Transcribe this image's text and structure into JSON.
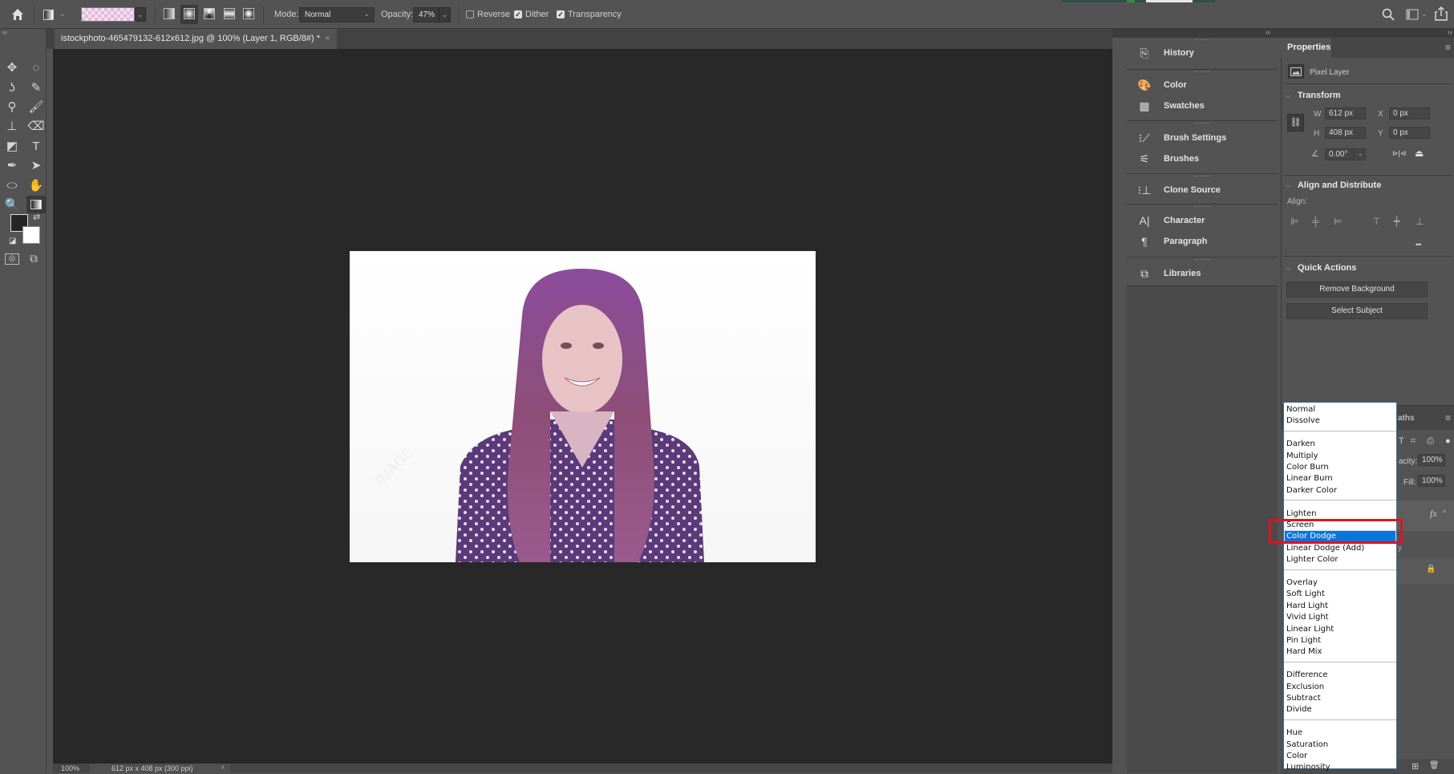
{
  "options_bar": {
    "home_icon": "home-icon",
    "gradient_tool_icon": "gradient-tool-icon",
    "gradient_preset": "transparent-pink-checker",
    "gradient_types": [
      "linear",
      "radial",
      "angle",
      "reflected",
      "diamond"
    ],
    "selected_gradient_type": "radial",
    "mode_label": "Mode:",
    "mode_value": "Normal",
    "opacity_label": "Opacity:",
    "opacity_value": "47%",
    "reverse_label": "Reverse",
    "reverse_checked": false,
    "dither_label": "Dither",
    "dither_checked": true,
    "transparency_label": "Transparency",
    "transparency_checked": true,
    "check_glyph": "✓",
    "dropdown_glyph": "⌄",
    "search_icon": "search-icon",
    "workspace_icon": "workspace-icon",
    "share_icon": "share-icon"
  },
  "document": {
    "tab_title": "istockphoto-465479132-612x612.jpg @ 100% (Layer 1, RGB/8#) *",
    "close_glyph": "×"
  },
  "toolbar": {
    "collapse_glyph": "‹‹",
    "tools": [
      {
        "name": "move-tool",
        "glyph": "✥"
      },
      {
        "name": "elliptical-marquee-tool",
        "glyph": "◌"
      },
      {
        "name": "lasso-tool",
        "glyph": "ʖ"
      },
      {
        "name": "quick-selection-tool",
        "glyph": "✎"
      },
      {
        "name": "eyedropper-tool",
        "glyph": "⚲"
      },
      {
        "name": "brush-tool",
        "glyph": "🖌"
      },
      {
        "name": "clone-stamp-tool",
        "glyph": "⊥"
      },
      {
        "name": "eraser-tool",
        "glyph": "⌫"
      },
      {
        "name": "paint-bucket-tool",
        "glyph": "◩"
      },
      {
        "name": "type-tool",
        "glyph": "T"
      },
      {
        "name": "pen-tool",
        "glyph": "✒"
      },
      {
        "name": "path-selection-tool",
        "glyph": "➤"
      },
      {
        "name": "ellipse-tool",
        "glyph": "⬭"
      },
      {
        "name": "hand-tool",
        "glyph": "✋"
      },
      {
        "name": "zoom-tool",
        "glyph": "🔍"
      },
      {
        "name": "gradient-tool",
        "glyph": "▣"
      }
    ],
    "swap_glyph": "⇄",
    "default_colors_glyph": "◪",
    "quick_mask_glyph": "◎",
    "screen_mode_glyph": "⧉",
    "foreground_color": "#262626",
    "background_color": "#ffffff"
  },
  "status_bar": {
    "zoom": "100%",
    "doc_info": "612 px x 408 px (300 ppi)",
    "arrow": "›"
  },
  "dock": {
    "collapse_glyph": "‹‹",
    "expand_glyph": "››",
    "items": [
      {
        "label": "History",
        "icon": "history-icon",
        "glyph": "⎘"
      },
      {
        "label": "Color",
        "icon": "color-palette-icon",
        "glyph": "🎨"
      },
      {
        "label": "Swatches",
        "icon": "swatches-grid-icon",
        "glyph": "▦"
      },
      {
        "label": "Brush Settings",
        "icon": "brush-settings-icon",
        "glyph": "⁝⟋"
      },
      {
        "label": "Brushes",
        "icon": "brushes-icon",
        "glyph": "⚟"
      },
      {
        "label": "Clone Source",
        "icon": "clone-source-icon",
        "glyph": "⁝⊥"
      },
      {
        "label": "Character",
        "icon": "character-icon",
        "glyph": "A|"
      },
      {
        "label": "Paragraph",
        "icon": "paragraph-icon",
        "glyph": "¶"
      },
      {
        "label": "Libraries",
        "icon": "libraries-icon",
        "glyph": "⧉"
      }
    ]
  },
  "properties": {
    "tab_label": "Properties",
    "menu_glyph": "≡",
    "layer_type": "Pixel Layer",
    "transform": {
      "title": "Transform",
      "w_label": "W",
      "w_value": "612 px",
      "h_label": "H",
      "h_value": "408 px",
      "x_label": "X",
      "x_value": "0 px",
      "y_label": "Y",
      "y_value": "0 px",
      "angle_value": "0.00°",
      "link_glyph": "⛓",
      "flip_h_glyph": "⊳|⊲",
      "flip_v_glyph": "⏏"
    },
    "align": {
      "title": "Align and Distribute",
      "align_label": "Align:",
      "buttons": [
        {
          "name": "align-left-edges",
          "glyph": "⊫"
        },
        {
          "name": "align-horizontal-centers",
          "glyph": "╪"
        },
        {
          "name": "align-right-edges",
          "glyph": "⊨"
        },
        {
          "name": "align-top-edges",
          "glyph": "⊤"
        },
        {
          "name": "align-vertical-centers",
          "glyph": "┿"
        },
        {
          "name": "align-bottom-edges",
          "glyph": "⊥"
        }
      ],
      "more_glyph": "•••"
    },
    "quick_actions": {
      "title": "Quick Actions",
      "remove_background": "Remove Background",
      "select_subject": "Select Subject"
    },
    "chevron_glyph": "⌵"
  },
  "layers_panel": {
    "tab_partial": "aths",
    "opacity_label": "acity:",
    "opacity_value": "100%",
    "fill_label": "Fill:",
    "fill_value": "100%",
    "fx_glyph": "fx",
    "caret_glyph": "^",
    "layer_partial_text": "y",
    "lock_glyph": "🔒",
    "new_layer_glyph": "⊞",
    "delete_glyph": "🗑",
    "menu_glyph": "≡",
    "filter_icons": [
      "T",
      "⌗",
      "⎙",
      "●"
    ]
  },
  "blend_mode_menu": {
    "selected": "Color Dodge",
    "groups": [
      [
        "Normal",
        "Dissolve"
      ],
      [
        "Darken",
        "Multiply",
        "Color Burn",
        "Linear Burn",
        "Darker Color"
      ],
      [
        "Lighten",
        "Screen",
        "Color Dodge",
        "Linear Dodge (Add)",
        "Lighter Color"
      ],
      [
        "Overlay",
        "Soft Light",
        "Hard Light",
        "Vivid Light",
        "Linear Light",
        "Pin Light",
        "Hard Mix"
      ],
      [
        "Difference",
        "Exclusion",
        "Subtract",
        "Divide"
      ],
      [
        "Hue",
        "Saturation",
        "Color",
        "Luminosity"
      ]
    ],
    "highlight_color": "#0a74da",
    "annotation_color": "#e0141f"
  },
  "canvas": {
    "image_alt": "portrait of smiling woman with long hair in purple polka-dot blouse, purple color overlay",
    "watermark_text": "IMAGE"
  }
}
